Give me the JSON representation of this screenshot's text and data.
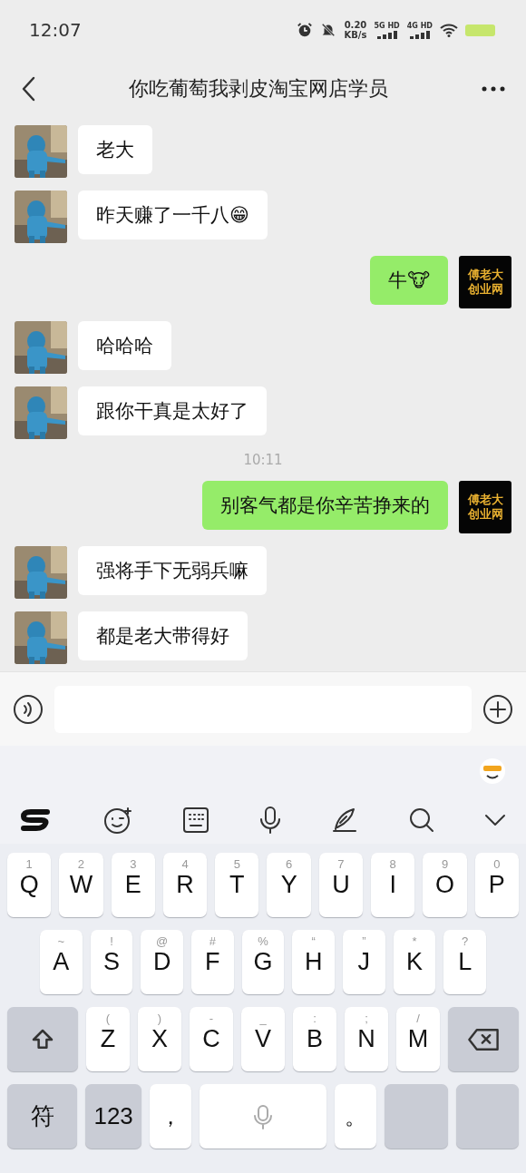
{
  "status_bar": {
    "time": "12:07",
    "speed_value": "0.20",
    "speed_unit": "KB/s",
    "networks": [
      "5G HD",
      "4G HD"
    ]
  },
  "header": {
    "title": "你吃葡萄我剥皮淘宝网店学员"
  },
  "messages": [
    {
      "kind": "message",
      "outgoing": false,
      "text": "老大"
    },
    {
      "kind": "message",
      "outgoing": false,
      "text": "昨天赚了一千八😁"
    },
    {
      "kind": "message",
      "outgoing": true,
      "text": "牛🐮",
      "avatar_lines": [
        "傅老大",
        "创业网"
      ]
    },
    {
      "kind": "message",
      "outgoing": false,
      "text": "哈哈哈"
    },
    {
      "kind": "message",
      "outgoing": false,
      "text": "跟你干真是太好了"
    },
    {
      "kind": "time",
      "text": "10:11"
    },
    {
      "kind": "message",
      "outgoing": true,
      "text": "别客气都是你辛苦挣来的",
      "avatar_lines": [
        "傅老大",
        "创业网"
      ]
    },
    {
      "kind": "message",
      "outgoing": false,
      "text": "强将手下无弱兵嘛"
    },
    {
      "kind": "message",
      "outgoing": false,
      "text": "都是老大带得好"
    }
  ],
  "keyboard": {
    "rows": [
      [
        {
          "kind": "char",
          "label": "Q",
          "hint": "1"
        },
        {
          "kind": "char",
          "label": "W",
          "hint": "2"
        },
        {
          "kind": "char",
          "label": "E",
          "hint": "3"
        },
        {
          "kind": "char",
          "label": "R",
          "hint": "4"
        },
        {
          "kind": "char",
          "label": "T",
          "hint": "5"
        },
        {
          "kind": "char",
          "label": "Y",
          "hint": "6"
        },
        {
          "kind": "char",
          "label": "U",
          "hint": "7"
        },
        {
          "kind": "char",
          "label": "I",
          "hint": "8"
        },
        {
          "kind": "char",
          "label": "O",
          "hint": "9"
        },
        {
          "kind": "char",
          "label": "P",
          "hint": "0"
        }
      ],
      [
        {
          "kind": "char",
          "label": "A",
          "hint": "~"
        },
        {
          "kind": "char",
          "label": "S",
          "hint": "!"
        },
        {
          "kind": "char",
          "label": "D",
          "hint": "@"
        },
        {
          "kind": "char",
          "label": "F",
          "hint": "#"
        },
        {
          "kind": "char",
          "label": "G",
          "hint": "%"
        },
        {
          "kind": "char",
          "label": "H",
          "hint": "“"
        },
        {
          "kind": "char",
          "label": "J",
          "hint": "”"
        },
        {
          "kind": "char",
          "label": "K",
          "hint": "*"
        },
        {
          "kind": "char",
          "label": "L",
          "hint": "?"
        }
      ],
      [
        {
          "kind": "shift"
        },
        {
          "kind": "char",
          "label": "Z",
          "hint": "("
        },
        {
          "kind": "char",
          "label": "X",
          "hint": ")"
        },
        {
          "kind": "char",
          "label": "C",
          "hint": "-"
        },
        {
          "kind": "char",
          "label": "V",
          "hint": "_"
        },
        {
          "kind": "char",
          "label": "B",
          "hint": ":"
        },
        {
          "kind": "char",
          "label": "N",
          "hint": ";"
        },
        {
          "kind": "char",
          "label": "M",
          "hint": "/"
        },
        {
          "kind": "backspace"
        }
      ],
      [
        {
          "kind": "function",
          "label": "符"
        },
        {
          "kind": "function",
          "label": "123"
        },
        {
          "kind": "punct",
          "label": "，"
        },
        {
          "kind": "space"
        },
        {
          "kind": "punct",
          "label": "。"
        },
        {
          "kind": "blank"
        },
        {
          "kind": "blank"
        }
      ]
    ]
  }
}
